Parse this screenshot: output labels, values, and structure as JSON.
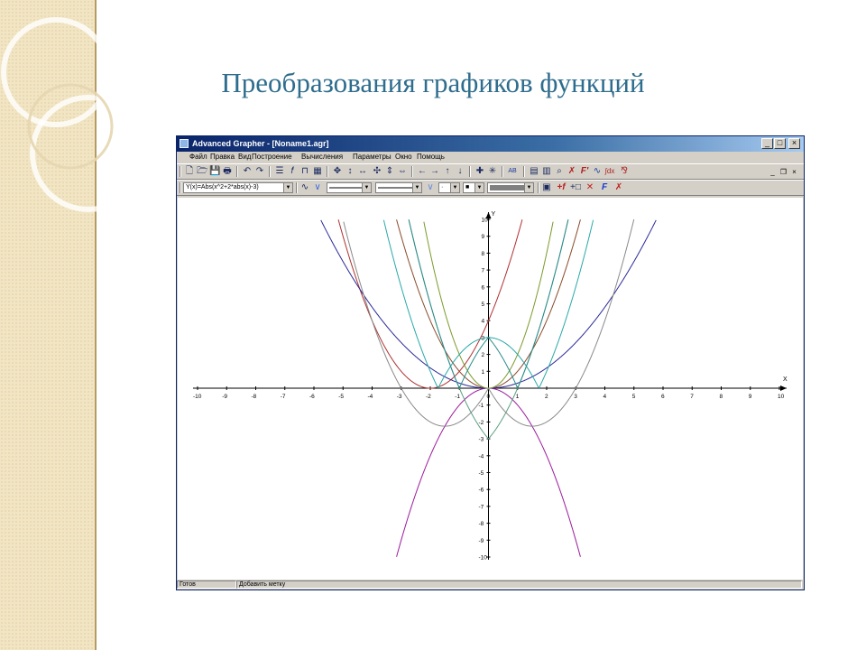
{
  "slide": {
    "title": "Преобразования графиков функций",
    "title_color": "#2e6d8e",
    "accent_color": "#f1e5c4"
  },
  "window": {
    "title": "Advanced Grapher - [Noname1.agr]",
    "buttons": {
      "minimize": "_",
      "maximize": "□",
      "close": "×"
    },
    "mdi_buttons": {
      "minimize": "_",
      "restore": "❐",
      "close": "×"
    },
    "menu": [
      "Файл",
      "Правка",
      "Вид",
      "Построение",
      "Вычисления",
      "Параметры",
      "Окно",
      "Помощь"
    ],
    "function_combo": "Y(x)=Abs(x^2+2*abs(x)-3)",
    "status": {
      "left": "Готов",
      "right": "Добавить метку"
    }
  },
  "toolbar1_icons": [
    "new-file-icon",
    "open-file-icon",
    "save-icon",
    "print-icon",
    "undo-icon",
    "redo-icon",
    "function-list-icon",
    "add-function-icon",
    "table-icon",
    "grid-icon",
    "move-icon",
    "stretch-vertical-icon",
    "stretch-horizontal-icon",
    "move-all-icon",
    "shrink-vertical-icon",
    "shrink-horizontal-icon",
    "arrow-left-icon",
    "arrow-right-icon",
    "arrow-up-icon",
    "arrow-down-icon",
    "crosshair-icon",
    "zoom-icon",
    "label-icon",
    "document-icon",
    "table-view-icon",
    "measure-icon",
    "tangent-icon",
    "derivative-icon",
    "curve-icon",
    "integral-icon",
    "fraction-icon"
  ],
  "toolbar2_icons": [
    "curve-style-icon",
    "curve-style-2-icon",
    "settings-icon",
    "add-function-red-icon",
    "add-point-icon",
    "delete-icon",
    "f-blue-icon",
    "tangent-red-icon"
  ],
  "chart_data": {
    "type": "line",
    "xlim": [
      -10,
      10
    ],
    "ylim": [
      -10,
      10
    ],
    "xlabel": "X",
    "ylabel": "Y",
    "x_ticks": [
      "-10",
      "-9",
      "-8",
      "-7",
      "-6",
      "-5",
      "-4",
      "-3",
      "-2",
      "-1",
      "0",
      "1",
      "2",
      "3",
      "4",
      "5",
      "6",
      "7",
      "8",
      "9",
      "10"
    ],
    "y_ticks": [
      "10",
      "9",
      "8",
      "7",
      "6",
      "5",
      "4",
      "3",
      "2",
      "1",
      "-1",
      "-2",
      "-3",
      "-4",
      "-5",
      "-6",
      "-7",
      "-8",
      "-9",
      "-10"
    ],
    "grid": false,
    "series": [
      {
        "expr": "x^2",
        "color": "#8b4a2b"
      },
      {
        "expr": "-x^2",
        "color": "#9c1b9c"
      },
      {
        "expr": "(x+2)^2",
        "color": "#b03030"
      },
      {
        "expr": "0.3*x^2",
        "color": "#2a2a9a"
      },
      {
        "expr": "2*x^2",
        "color": "#7a9a2a"
      },
      {
        "expr": "|x^2-3|",
        "color": "#2aa8a8"
      },
      {
        "expr": "x^2+2x-3 (even)",
        "color": "#5aa080"
      },
      {
        "expr": "|x^2+2|x|-3|",
        "color": "#2a8c8c"
      },
      {
        "expr": "x^2-3|x|",
        "color": "#8a8a8a"
      }
    ]
  }
}
